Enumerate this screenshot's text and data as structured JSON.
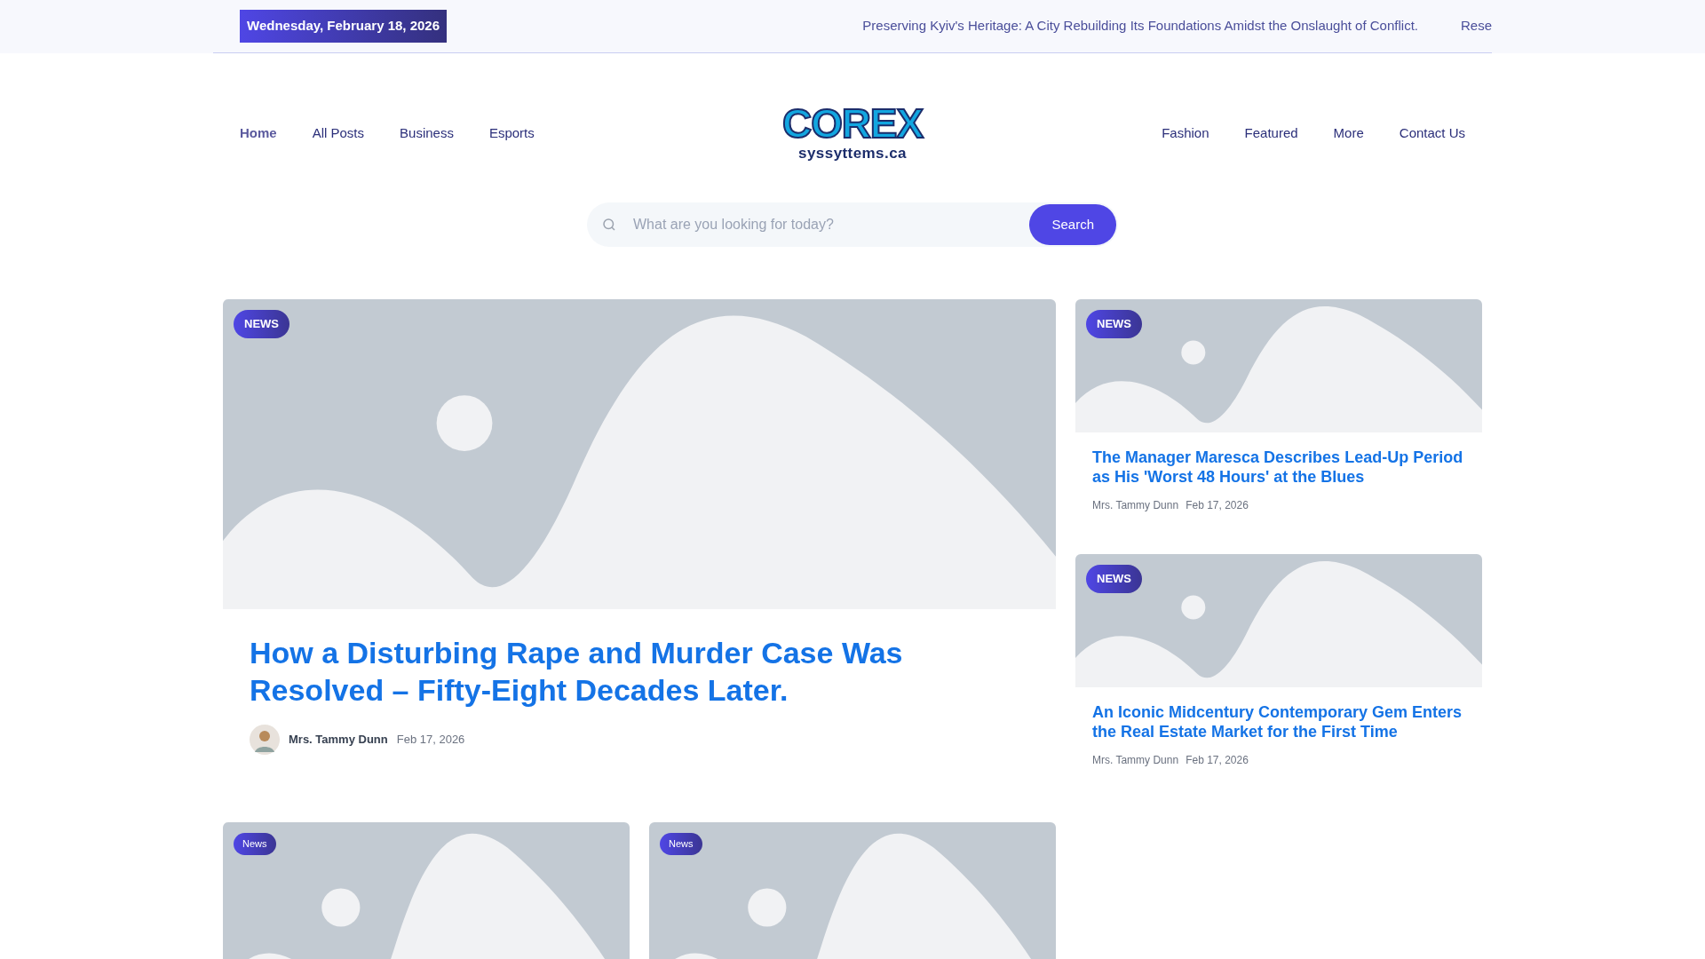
{
  "top_bar": {
    "date": "Wednesday, February 18, 2026",
    "ticker": [
      "Preserving Kyiv's Heritage: A City Rebuilding Its Foundations Amidst the Onslaught of Conflict.",
      "Rese"
    ]
  },
  "nav_left": [
    {
      "label": "Home",
      "selected": true
    },
    {
      "label": "All Posts",
      "selected": false
    },
    {
      "label": "Business",
      "selected": false
    },
    {
      "label": "Esports",
      "selected": false
    }
  ],
  "logo": {
    "wordmark": "COREX",
    "domain": "syssyttems.ca"
  },
  "nav_right": [
    {
      "label": "Fashion",
      "selected": false
    },
    {
      "label": "Featured",
      "selected": false
    },
    {
      "label": "More",
      "selected": false
    },
    {
      "label": "Contact Us",
      "selected": false
    }
  ],
  "search": {
    "placeholder": "What are you looking for today?",
    "button": "Search"
  },
  "featured": {
    "badge": "NEWS",
    "title": "How a Disturbing Rape and Murder Case Was Resolved – Fifty-Eight Decades Later.",
    "author": "Mrs. Tammy Dunn",
    "date": "Feb 17, 2026"
  },
  "side_posts": [
    {
      "badge": "NEWS",
      "title": "The Manager Maresca Describes Lead-Up Period as His 'Worst 48 Hours' at the Blues",
      "author": "Mrs. Tammy Dunn",
      "date": "Feb 17, 2026"
    },
    {
      "badge": "NEWS",
      "title": "An Iconic Midcentury Contemporary Gem Enters the Real Estate Market for the First Time",
      "author": "Mrs. Tammy Dunn",
      "date": "Feb 17, 2026"
    }
  ],
  "bottom_posts": [
    {
      "badge": "News"
    },
    {
      "badge": "News"
    }
  ]
}
